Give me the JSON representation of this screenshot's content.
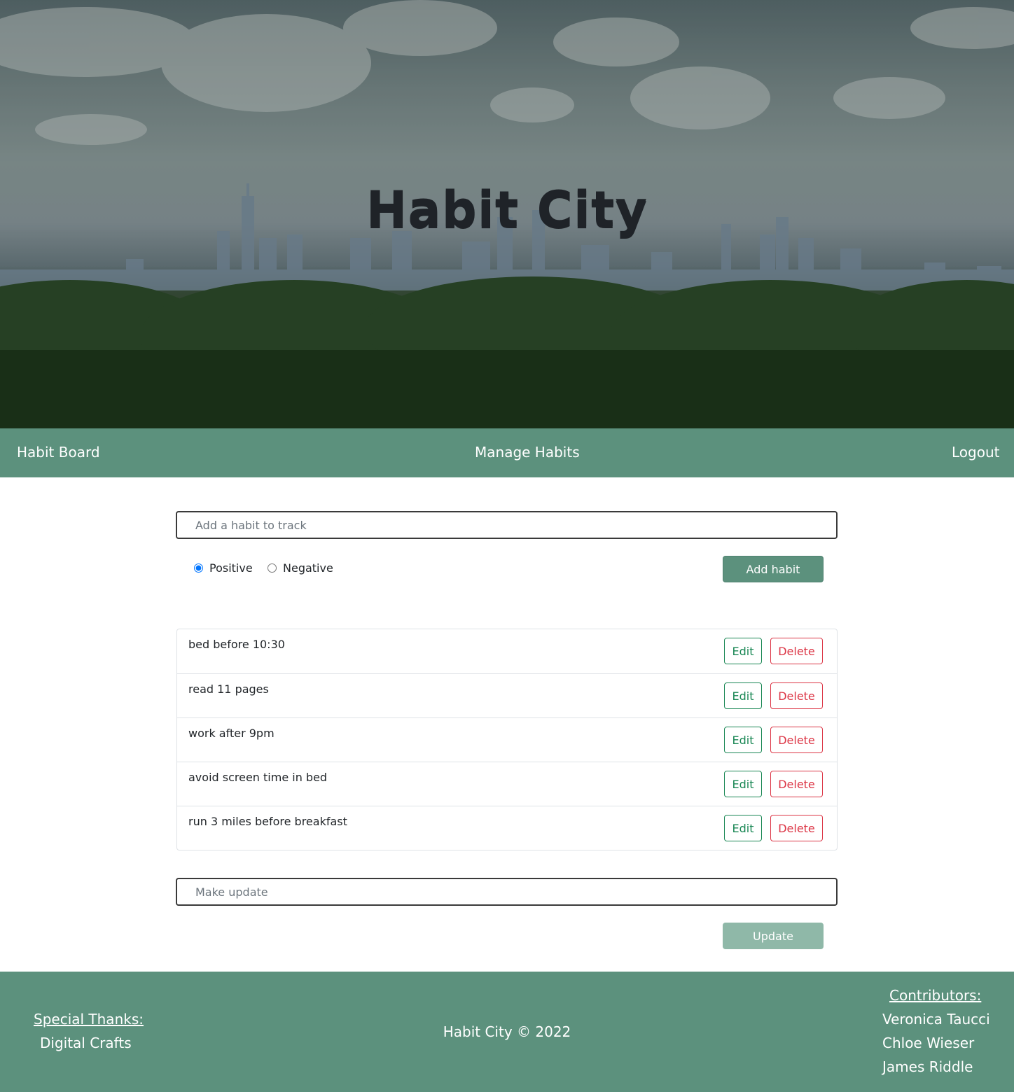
{
  "hero": {
    "title": "Habit City"
  },
  "nav": {
    "habit_board": "Habit Board",
    "manage_habits": "Manage Habits",
    "logout": "Logout"
  },
  "add_form": {
    "placeholder": "Add a habit to track",
    "positive_label": "Positive",
    "negative_label": "Negative",
    "selected": "Positive",
    "add_label": "Add habit"
  },
  "habits": [
    {
      "name": "bed before 10:30",
      "edit_label": "Edit",
      "delete_label": "Delete"
    },
    {
      "name": "read 11 pages",
      "edit_label": "Edit",
      "delete_label": "Delete"
    },
    {
      "name": "work after 9pm",
      "edit_label": "Edit",
      "delete_label": "Delete"
    },
    {
      "name": "avoid screen time in bed",
      "edit_label": "Edit",
      "delete_label": "Delete"
    },
    {
      "name": "run 3 miles before breakfast",
      "edit_label": "Edit",
      "delete_label": "Delete"
    }
  ],
  "update_form": {
    "placeholder": "Make update",
    "update_label": "Update"
  },
  "footer": {
    "thanks_heading": "Special Thanks:",
    "thanks_names": [
      "Digital Crafts"
    ],
    "copyright": "Habit City © 2022",
    "contributors_heading": "Contributors:",
    "contributors": [
      "Veronica Taucci",
      "Chloe Wieser",
      "James Riddle"
    ]
  },
  "colors": {
    "accent": "#5c917d",
    "edit": "#198754",
    "delete": "#dc3545"
  }
}
